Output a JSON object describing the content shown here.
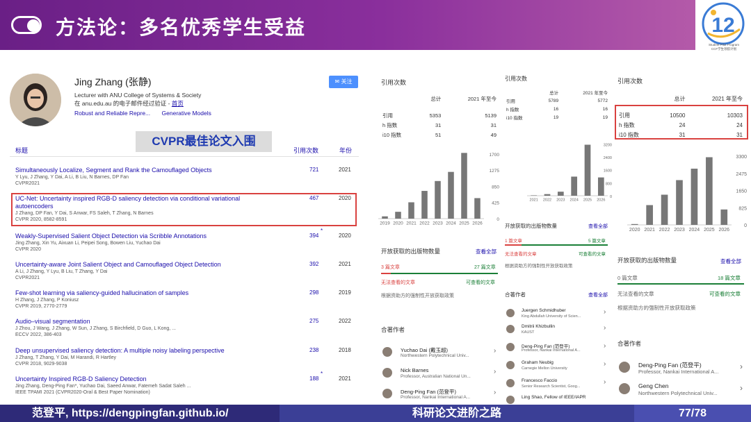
{
  "header": {
    "title": "方法论：多名优秀学生受益"
  },
  "logo": {
    "caption_1": "Student Pilot Program",
    "caption_2": "CCF学生领航计划"
  },
  "footer": {
    "left": "范登平, https://dengpingfan.github.io/",
    "middle": "科研论文进阶之路",
    "right": "77/78"
  },
  "profile": {
    "name": "Jing Zhang (张静)",
    "position": "Lecturer with ANU College of Systems & Society",
    "email_prefix": "在 anu.edu.au 的电子邮件经过验证 - ",
    "homepage": "首页",
    "tags": [
      "Robust and Reliable Repre...",
      "Generative Models"
    ],
    "follow": "关注"
  },
  "badge": "CVPR最佳论文入围",
  "table": {
    "col_title": "标题",
    "col_cited": "引用次数",
    "col_year": "年份"
  },
  "papers": [
    {
      "title": "Simultaneously Localize, Segment and Rank the Camouflaged Objects",
      "authors": "Y Lyu, J Zhang, Y Dai, A Li, B Liu, N Barnes, DP Fan",
      "venue": "CVPR2021",
      "cited": "721",
      "year": "2021",
      "star": ""
    },
    {
      "title": "UC-Net: Uncertainty inspired RGB-D saliency detection via conditional variational",
      "title2": "autoencoders",
      "authors": "J Zhang, DP Fan, Y Dai, S Anwar, FS Saleh, T Zhang, N Barnes",
      "venue": "CVPR 2020, 8582-8591",
      "cited": "467",
      "year": "2020",
      "star": ""
    },
    {
      "title": "Weakly-Supervised Salient Object Detection via Scribble Annotations",
      "authors": "Jing Zhang, Xin Yu, Aixuan Li, Peipei Song, Bowen Liu, Yuchao Dai",
      "venue": "CVPR 2020",
      "cited": "394",
      "year": "2020",
      "star": "*"
    },
    {
      "title": "Uncertainty-aware Joint Salient Object and Camouflaged Object Detection",
      "authors": "A Li, J Zhang, Y Lyu, B Liu, T Zhang, Y Dai",
      "venue": "CVPR2021",
      "cited": "392",
      "year": "2021",
      "star": ""
    },
    {
      "title": "Few-shot learning via saliency-guided hallucination of samples",
      "authors": "H Zhang, J Zhang, P Koniusz",
      "venue": "CVPR 2019, 2770-2779",
      "cited": "298",
      "year": "2019",
      "star": ""
    },
    {
      "title": "Audio–visual segmentation",
      "authors": "J Zhou, J Wang, J Zhang, W Sun, J Zhang, S Birchfield, D Guo, L Kong, ...",
      "venue": "ECCV 2022, 386-403",
      "cited": "275",
      "year": "2022",
      "star": ""
    },
    {
      "title": "Deep unsupervised saliency detection: A multiple noisy labeling perspective",
      "authors": "J Zhang, T Zhang, Y Dai, M Harandi, R Hartley",
      "venue": "CVPR 2018, 9029-9038",
      "cited": "238",
      "year": "2018",
      "star": ""
    },
    {
      "title": "Uncertainty Inspired RGB-D Saliency Detection",
      "authors": "Jing Zhang, Deng-Ping Fan*, Yuchao Dai, Saeed Anwar, Fatemeh Sadat Saleh ...",
      "venue": "IEEE TPAMI 2021 (CVPR2020-Oral & Best Paper Nomination)",
      "cited": "188",
      "year": "2021",
      "star": "*"
    }
  ],
  "panels": [
    {
      "title": "引用次数",
      "h_total": "总计",
      "h_since": "2021 年至今",
      "rows": [
        [
          "引用",
          "5353",
          "5139"
        ],
        [
          "h 指数",
          "31",
          "31"
        ],
        [
          "i10 指数",
          "51",
          "49"
        ]
      ],
      "oa_title": "开放获取的出版物数量",
      "see_all": "查看全部",
      "oa_avail": "3 篇文章",
      "oa_na": "27 篇文章",
      "oa_avail_label": "无法查看的文章",
      "oa_na_label": "可查看的文章",
      "oa_note": "根据资助方的强制性开放获取政策",
      "coauthor_title": "合著作者",
      "coauthors": [
        {
          "name": "Yuchao Dai (戴玉超)",
          "aff": "Northwestern Polytechnical Univ..."
        },
        {
          "name": "Nick Barnes",
          "aff": "Professor, Australian National Un..."
        },
        {
          "name": "Deng-Ping Fan (范登平)",
          "aff": "Professor, Nankai International A..."
        }
      ]
    },
    {
      "title": "引用次数",
      "h_total": "总计",
      "h_since": "2021 年至今",
      "rows": [
        [
          "引用",
          "5789",
          "5772"
        ],
        [
          "h 指数",
          "16",
          "16"
        ],
        [
          "i10 指数",
          "19",
          "19"
        ]
      ],
      "oa_title": "开放获取的出版物数量",
      "see_all": "查看全部",
      "oa_avail": "1 篇文章",
      "oa_na": "5 篇文章",
      "oa_avail_label": "无法查看的文章",
      "oa_na_label": "可查看的文章",
      "oa_note": "根据资助方的强制性开放获取政策",
      "coauthor_title": "合著作者",
      "coauthors": [
        {
          "name": "Juergen Schmidhuber",
          "aff": "King Abdullah University of Scien..."
        },
        {
          "name": "Dmitrii Khizbullin",
          "aff": "KAUST"
        },
        {
          "name": "Deng-Ping Fan (范登平)",
          "aff": "Professor, Nankai International A..."
        },
        {
          "name": "Graham Neubig",
          "aff": "Carnegie Mellon University"
        },
        {
          "name": "Francesco Faccio",
          "aff": "Senior Research Scientist, Goog..."
        },
        {
          "name": "Ling Shao, Fellow of IEEE/IAPR",
          "aff": ""
        }
      ]
    },
    {
      "title": "引用次数",
      "h_total": "总计",
      "h_since": "2021 年至今",
      "rows": [
        [
          "引用",
          "10500",
          "10303"
        ],
        [
          "h 指数",
          "24",
          "24"
        ],
        [
          "i10 指数",
          "31",
          "31"
        ]
      ],
      "oa_title": "开放获取的出版物数量",
      "see_all": "查看全部",
      "oa_avail": "0 篇文章",
      "oa_na": "18 篇文章",
      "oa_avail_label": "无法查看的文章",
      "oa_na_label": "可查看的文章",
      "oa_note": "根据资助方的强制性开放获取政策",
      "coauthor_title": "合著作者",
      "coauthors": [
        {
          "name": "Deng-Ping Fan (范登平)",
          "aff": "Professor, Nankai International A..."
        },
        {
          "name": "Geng Chen",
          "aff": "Northwestern Polytechnical Univ..."
        }
      ]
    }
  ],
  "chart_data": [
    {
      "type": "bar",
      "categories": [
        "2019",
        "2020",
        "2021",
        "2022",
        "2023",
        "2024",
        "2025",
        "2026"
      ],
      "values": [
        60,
        180,
        430,
        730,
        990,
        1230,
        1730,
        540
      ],
      "yticks": [
        "1700",
        "1275",
        "850",
        "425",
        "0"
      ],
      "ylim": [
        0,
        1900
      ]
    },
    {
      "type": "bar",
      "categories": [
        "2021",
        "2022",
        "2023",
        "2024",
        "2025",
        "2026"
      ],
      "values": [
        25,
        100,
        250,
        1180,
        3150,
        1130
      ],
      "yticks": [
        "3200",
        "2400",
        "1600",
        "800",
        "0"
      ],
      "ylim": [
        0,
        3600
      ]
    },
    {
      "type": "bar",
      "categories": [
        "2020",
        "2021",
        "2022",
        "2023",
        "2024",
        "2025",
        "2026"
      ],
      "values": [
        40,
        950,
        1450,
        2150,
        2700,
        3250,
        740
      ],
      "yticks": [
        "3300",
        "2475",
        "1650",
        "825",
        "0"
      ],
      "ylim": [
        0,
        3600
      ]
    }
  ]
}
